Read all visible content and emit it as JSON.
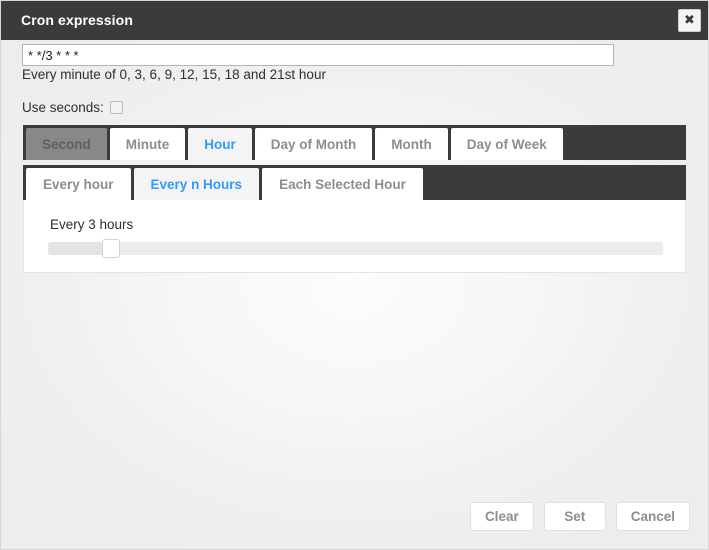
{
  "dialog": {
    "title": "Cron expression",
    "close_icon": "close-icon",
    "close_glyph": "✖"
  },
  "expression": {
    "value": "* */3 * * *",
    "placeholder": "Cron expression",
    "description": "Every minute of 0, 3, 6, 9, 12, 15, 18 and 21st hour"
  },
  "options": {
    "use_seconds_label": "Use seconds:",
    "use_seconds_checked": false
  },
  "main_tabs": [
    {
      "label": "Second",
      "state": "disabled"
    },
    {
      "label": "Minute",
      "state": "normal"
    },
    {
      "label": "Hour",
      "state": "active"
    },
    {
      "label": "Day of Month",
      "state": "normal"
    },
    {
      "label": "Month",
      "state": "normal"
    },
    {
      "label": "Day of Week",
      "state": "normal"
    }
  ],
  "sub_tabs": [
    {
      "label": "Every hour",
      "state": "normal"
    },
    {
      "label": "Every n Hours",
      "state": "active"
    },
    {
      "label": "Each Selected Hour",
      "state": "normal"
    }
  ],
  "panel": {
    "slider_caption": "Every 3 hours",
    "slider": {
      "value": 3,
      "min": 1,
      "max": 24
    }
  },
  "footer": {
    "clear_label": "Clear",
    "set_label": "Set",
    "cancel_label": "Cancel"
  },
  "colors": {
    "titlebar": "#3b3b3b",
    "tabstrip": "#3b3b3b",
    "accent_blue": "#3399ff",
    "tab_text": "#8d8d8d",
    "background": "#efefef",
    "panel": "#ffffff"
  }
}
